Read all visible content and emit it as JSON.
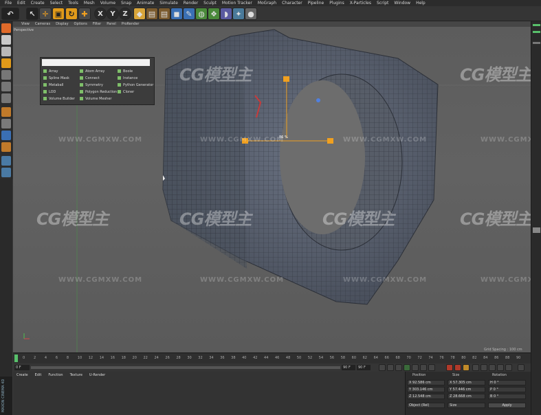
{
  "menubar": [
    "File",
    "Edit",
    "Create",
    "Select",
    "Tools",
    "Mesh",
    "Volume",
    "Snap",
    "Animate",
    "Simulate",
    "Render",
    "Sculpt",
    "Motion Tracker",
    "MoGraph",
    "Character",
    "Pipeline",
    "Plugins",
    "X-Particles",
    "Script",
    "Window",
    "Help"
  ],
  "toolbar": {
    "x_label": "X",
    "y_label": "Y",
    "z_label": "Z"
  },
  "viewport": {
    "menu": [
      "View",
      "Cameras",
      "Display",
      "Options",
      "Filter",
      "Panel",
      "ProRender"
    ],
    "label": "Perspective",
    "generators": [
      "Array",
      "Atom Array",
      "Boole",
      "Spline Mask",
      "Connect",
      "Instance",
      "Metaball",
      "Symmetry",
      "Python Generator",
      "LOD",
      "Polygon Reduction",
      "Cloner",
      "Volume Builder",
      "Volume Mesher"
    ],
    "grid_spacing": "Grid Spacing : 100 cm",
    "handle_readout": "86 %",
    "watermark_big": "CG模型主",
    "watermark_url": "WWW.CGMXW.COM"
  },
  "timeline": {
    "ticks": [
      "0",
      "2",
      "4",
      "6",
      "8",
      "10",
      "12",
      "14",
      "16",
      "18",
      "20",
      "22",
      "24",
      "26",
      "28",
      "30",
      "32",
      "34",
      "36",
      "38",
      "40",
      "42",
      "44",
      "46",
      "48",
      "50",
      "52",
      "54",
      "56",
      "58",
      "60",
      "62",
      "64",
      "66",
      "68",
      "70",
      "72",
      "74",
      "76",
      "78",
      "80",
      "82",
      "84",
      "86",
      "88",
      "90"
    ],
    "start_field": "0 F",
    "end_field": "90 F",
    "end_field2": "90 F"
  },
  "material_menu": [
    "Create",
    "Edit",
    "Function",
    "Texture",
    "U-Render"
  ],
  "coords": {
    "headers": [
      "Position",
      "Size",
      "Rotation"
    ],
    "position": [
      {
        "axis": "X",
        "value": "92.586 cm"
      },
      {
        "axis": "Y",
        "value": "303.146 cm"
      },
      {
        "axis": "Z",
        "value": "12.548 cm"
      }
    ],
    "size": [
      {
        "axis": "X",
        "value": "57.305 cm"
      },
      {
        "axis": "Y",
        "value": "57.446 cm"
      },
      {
        "axis": "Z",
        "value": "28.668 cm"
      }
    ],
    "rotation": [
      {
        "axis": "H",
        "value": "0 °"
      },
      {
        "axis": "P",
        "value": "0 °"
      },
      {
        "axis": "B",
        "value": "0 °"
      }
    ],
    "mode": "Object (Rel)",
    "size_mode": "Size",
    "apply": "Apply"
  },
  "maxon": "MAXON CINEMA 4D",
  "colors": {
    "accent_orange": "#f0a020",
    "accent_green": "#58c06b",
    "mesh": "#525a66"
  }
}
